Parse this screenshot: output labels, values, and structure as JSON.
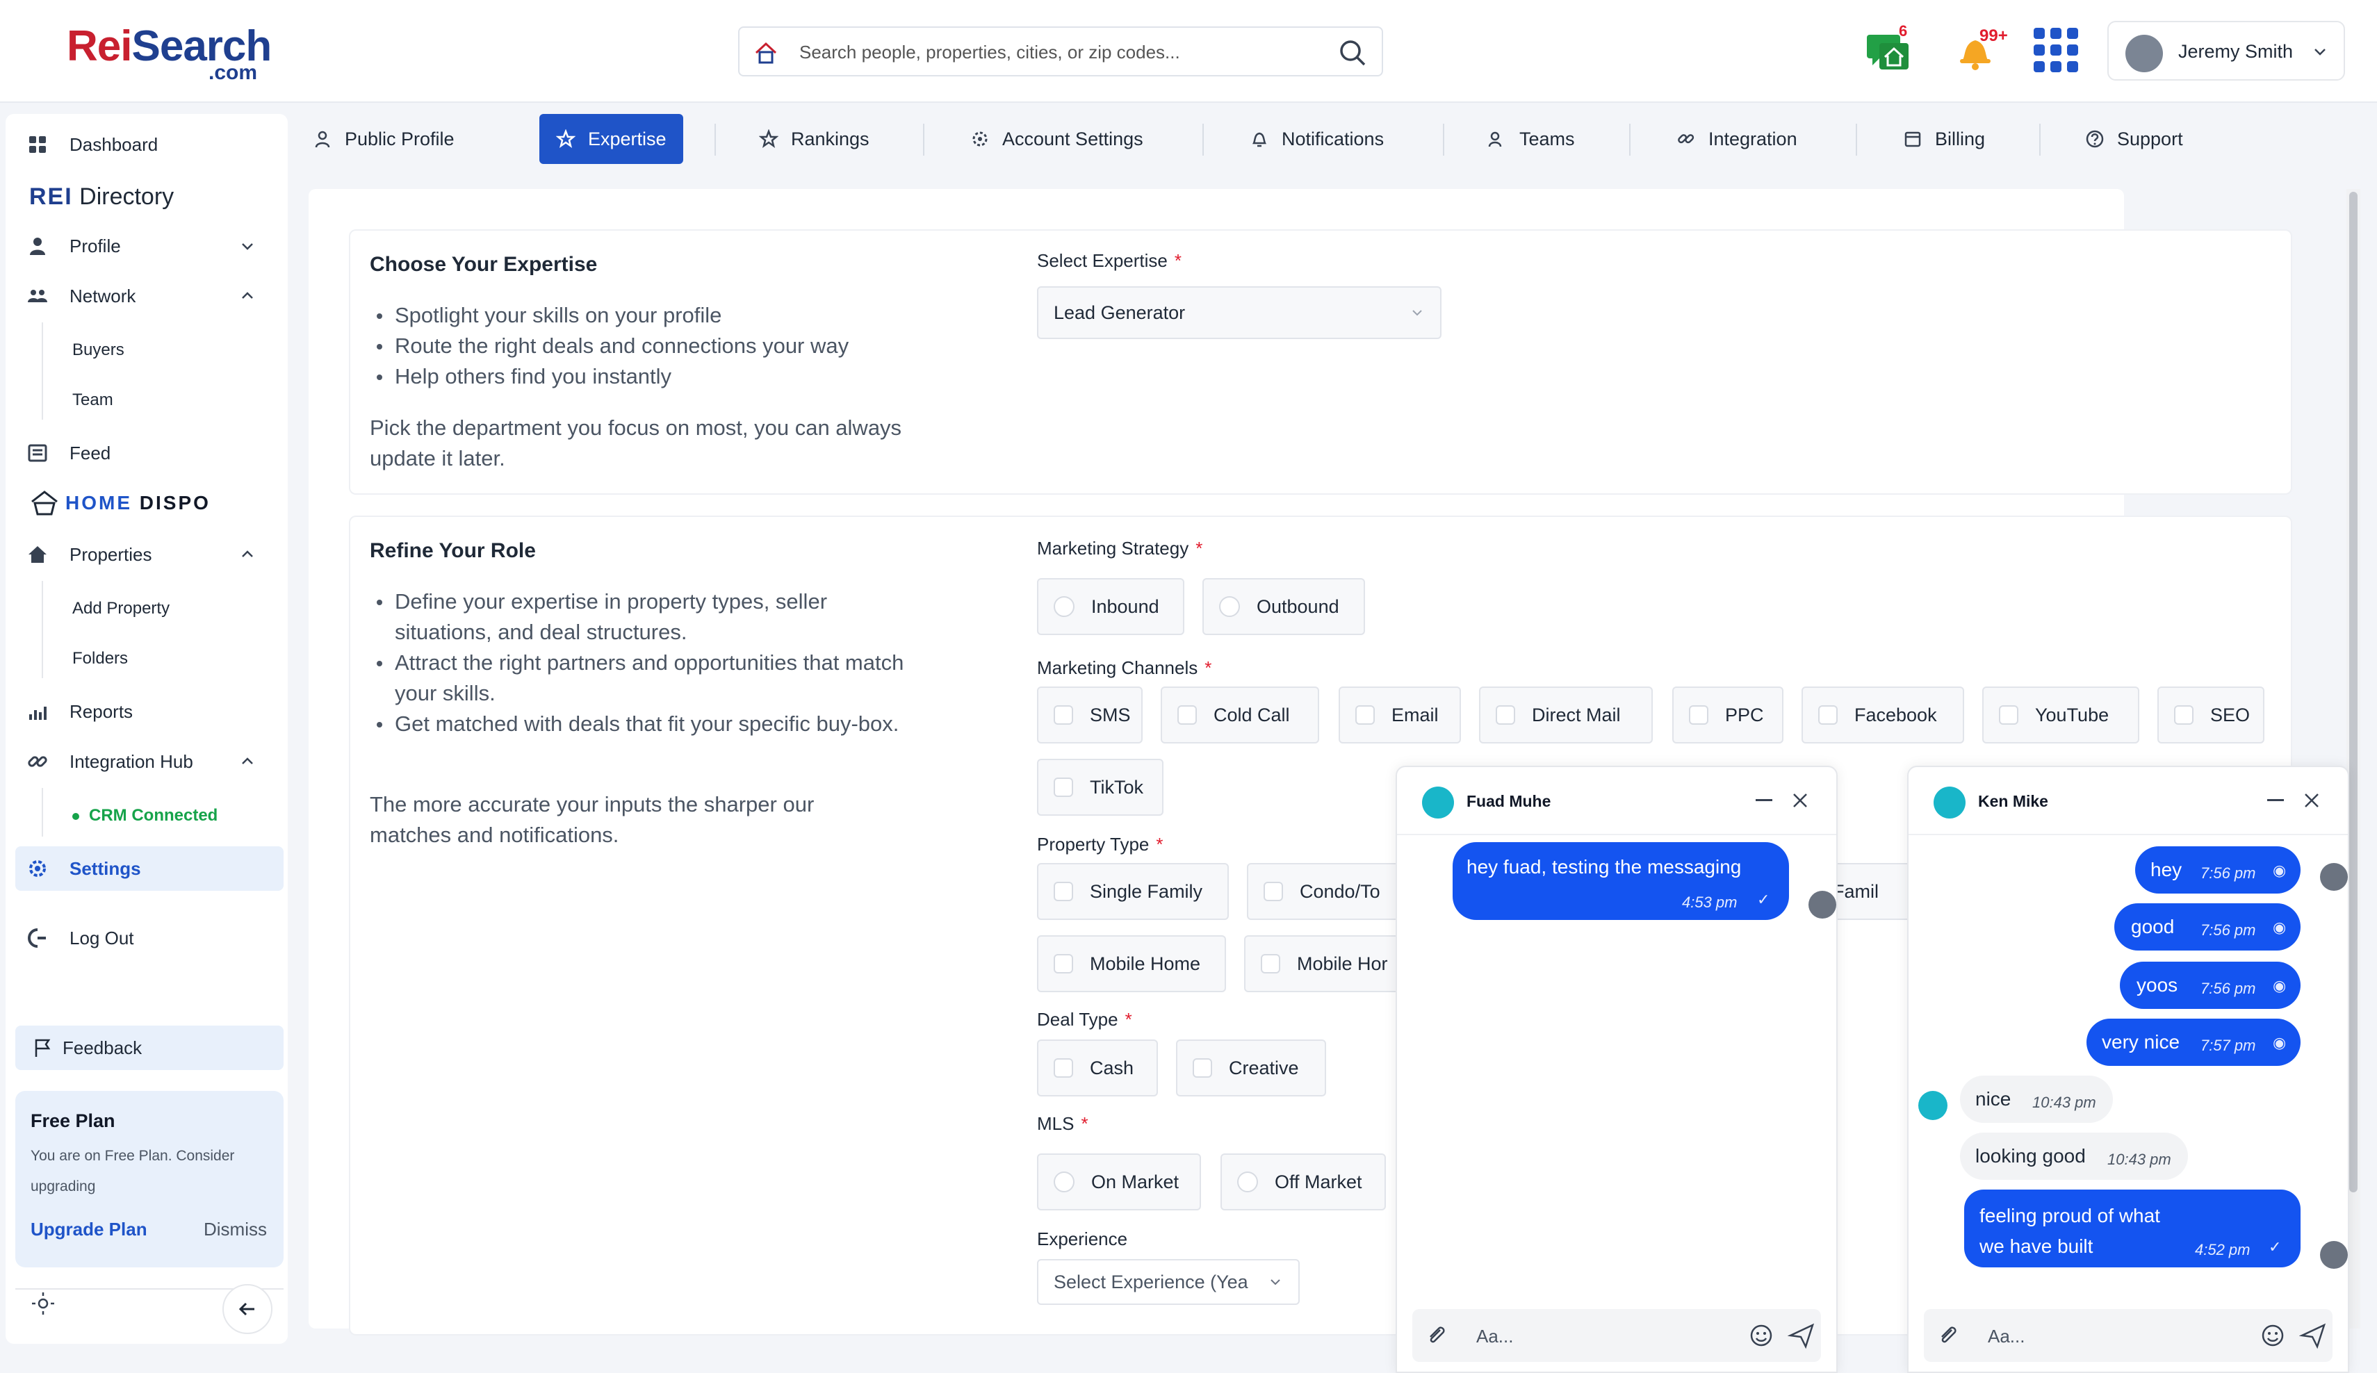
{
  "header": {
    "logo_main_a": "Rei",
    "logo_main_b": "Search",
    "logo_sub": ".com",
    "search_placeholder": "Search people, properties, cities, or zip codes...",
    "messages_badge": "6",
    "notifications_badge": "99+",
    "user_name": "Jeremy Smith"
  },
  "sidebar": {
    "dashboard": "Dashboard",
    "rei_directory_a": "REI",
    "rei_directory_b": "Directory",
    "profile": "Profile",
    "network": "Network",
    "buyers": "Buyers",
    "team": "Team",
    "feed": "Feed",
    "home_dispo_a": "HOME",
    "home_dispo_b": "DISPO",
    "properties": "Properties",
    "add_property": "Add Property",
    "folders": "Folders",
    "reports": "Reports",
    "integration_hub": "Integration Hub",
    "crm_connected": "CRM Connected",
    "settings": "Settings",
    "log_out": "Log Out",
    "feedback": "Feedback",
    "free_plan_title": "Free Plan",
    "free_plan_desc": "You are on Free Plan. Consider upgrading",
    "upgrade_plan": "Upgrade Plan",
    "dismiss": "Dismiss"
  },
  "tabs": [
    "Public Profile",
    "Expertise",
    "Rankings",
    "Account Settings",
    "Notifications",
    "Teams",
    "Integration",
    "Billing",
    "Support"
  ],
  "expertise": {
    "title": "Choose Your Expertise",
    "bullets": [
      "Spotlight your skills on your profile",
      "Route the right deals and connections your way",
      "Help others find you instantly"
    ],
    "para": "Pick the department you focus on most, you can always update it later.",
    "select_label": "Select Expertise",
    "select_value": "Lead Generator"
  },
  "refine": {
    "title": "Refine Your Role",
    "bullets": [
      "Define your expertise in property types, seller situations, and deal structures.",
      "Attract the right partners and opportunities that match your skills.",
      "Get matched with deals that fit your specific buy-box."
    ],
    "para": "The more accurate your inputs the sharper our matches and notifications.",
    "marketing_strategy_label": "Marketing Strategy",
    "marketing_strategy": [
      "Inbound",
      "Outbound"
    ],
    "marketing_channels_label": "Marketing Channels",
    "marketing_channels": [
      "SMS",
      "Cold Call",
      "Email",
      "Direct Mail",
      "PPC",
      "Facebook",
      "YouTube",
      "SEO",
      "TikTok"
    ],
    "property_type_label": "Property Type",
    "property_types": [
      "Single Family",
      "Condo/Townhouse",
      "Multi Family",
      "Mobile Home",
      "Mobile Home Park"
    ],
    "property_types_visible": [
      "Single Family",
      "Condo/To",
      "lti Famil",
      "Mobile Home",
      "Mobile Hor"
    ],
    "deal_type_label": "Deal Type",
    "deal_types": [
      "Cash",
      "Creative"
    ],
    "mls_label": "MLS",
    "mls": [
      "On Market",
      "Off Market"
    ],
    "experience_label": "Experience",
    "experience_placeholder": "Select Experience (Yea"
  },
  "chat1": {
    "name": "Fuad Muhe",
    "messages": [
      {
        "text": "hey fuad, testing the messaging",
        "time": "4:53 pm"
      }
    ],
    "placeholder": "Aa..."
  },
  "chat2": {
    "name": "Ken Mike",
    "messages": [
      {
        "text": "hey",
        "time": "7:56 pm",
        "dir": "out"
      },
      {
        "text": "good",
        "time": "7:56 pm",
        "dir": "out"
      },
      {
        "text": "yoos",
        "time": "7:56 pm",
        "dir": "out"
      },
      {
        "text": "very nice",
        "time": "7:57 pm",
        "dir": "out"
      },
      {
        "text": "nice",
        "time": "10:43 pm",
        "dir": "in"
      },
      {
        "text": "looking good",
        "time": "10:43 pm",
        "dir": "in"
      },
      {
        "text": "feeling proud of what we have built",
        "time": "4:52 pm",
        "dir": "out"
      }
    ],
    "placeholder": "Aa..."
  },
  "colors": {
    "accent": "#1f54c8",
    "bubble": "#1454f0",
    "brand_red": "#c8202f",
    "crm_green": "#16a34a"
  }
}
